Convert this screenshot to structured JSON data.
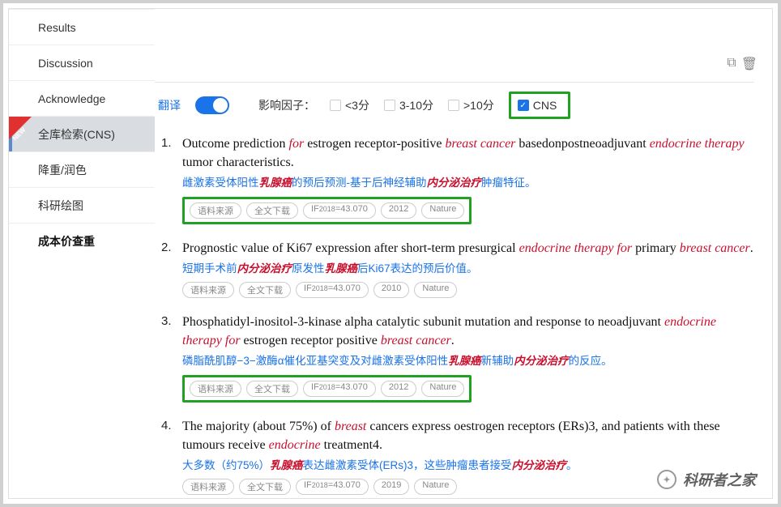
{
  "sidebar": {
    "items": [
      {
        "label": "Results"
      },
      {
        "label": "Discussion"
      },
      {
        "label": "Acknowledge"
      },
      {
        "label": "全库检索(CNS)",
        "badge": "NEW"
      },
      {
        "label": "降重/润色"
      },
      {
        "label": "科研绘图"
      },
      {
        "label": "成本价查重"
      }
    ]
  },
  "filters": {
    "translate_label": "翻译",
    "if_label": "影响因子：",
    "opt1": "<3分",
    "opt2": "3-10分",
    "opt3": ">10分",
    "cns": "CNS"
  },
  "tag_labels": {
    "source": "语料来源",
    "download": "全文下载",
    "if_prefix": "IF",
    "if_year": "2018"
  },
  "results": [
    {
      "num": "1.",
      "title_parts": [
        "Outcome prediction ",
        "for",
        " estrogen receptor-positive ",
        "breast cancer",
        " basedonpostneoadjuvant ",
        "endocrine therapy",
        " tumor characteristics."
      ],
      "hl": [
        1,
        3,
        5
      ],
      "trans_parts": [
        "雌激素受体阳性",
        "乳腺癌",
        "的预后预测-基于后神经辅助",
        "内分泌治疗",
        "肿瘤特征。"
      ],
      "trans_hl": [
        1,
        3
      ],
      "if": "=43.070",
      "year": "2012",
      "journal": "Nature",
      "boxed": true
    },
    {
      "num": "2.",
      "title_parts": [
        "Prognostic value of Ki67 expression after short-term presurgical ",
        "endocrine therapy for",
        " primary ",
        "breast cancer",
        "."
      ],
      "hl": [
        1,
        3
      ],
      "trans_parts": [
        "短期手术前",
        "内分泌治疗",
        "原发性",
        "乳腺癌",
        "后Ki67表达的预后价值。"
      ],
      "trans_hl": [
        1,
        3
      ],
      "if": "=43.070",
      "year": "2010",
      "journal": "Nature",
      "boxed": false
    },
    {
      "num": "3.",
      "title_parts": [
        "Phosphatidyl-inositol-3-kinase alpha catalytic subunit mutation and response to neoadjuvant ",
        "endocrine therapy for",
        " estrogen receptor positive ",
        "breast cancer",
        "."
      ],
      "hl": [
        1,
        3
      ],
      "trans_parts": [
        "磷脂酰肌醇−3−激酶α催化亚基突变及对雌激素受体阳性",
        "乳腺癌",
        "新辅助",
        "内分泌治疗",
        "的反应。"
      ],
      "trans_hl": [
        1,
        3
      ],
      "if": "=43.070",
      "year": "2012",
      "journal": "Nature",
      "boxed": true
    },
    {
      "num": "4.",
      "title_parts": [
        "The majority (about 75%) of ",
        "breast",
        " cancers express oestrogen receptors (ERs)3, and patients with these tumours receive ",
        "endocrine",
        " treatment4."
      ],
      "hl": [
        1,
        3
      ],
      "trans_parts": [
        "大多数（约75%）",
        "乳腺癌",
        "表达雌激素受体(ERs)3，这些肿瘤患者接受",
        "内分泌治疗",
        "。"
      ],
      "trans_hl": [
        1,
        3
      ],
      "if": "=43.070",
      "year": "2019",
      "journal": "Nature",
      "boxed": false
    }
  ],
  "watermark": "科研者之家"
}
